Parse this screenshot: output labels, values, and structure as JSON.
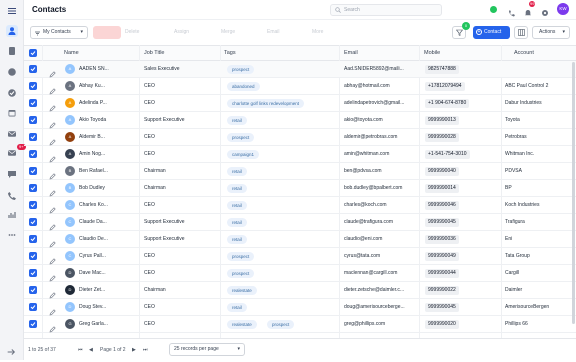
{
  "rail_items": [
    {
      "name": "menu-icon",
      "glyph": "menu"
    },
    {
      "name": "contacts-icon",
      "glyph": "person"
    },
    {
      "name": "building-icon",
      "glyph": "doc"
    },
    {
      "name": "deals-icon",
      "glyph": "circle"
    },
    {
      "name": "tasks-icon",
      "glyph": "check"
    },
    {
      "name": "calendar-icon",
      "glyph": "cal"
    },
    {
      "name": "mail-icon",
      "glyph": "mail"
    },
    {
      "name": "inbox-icon",
      "glyph": "mail",
      "badge": "9+"
    },
    {
      "name": "chat-icon",
      "glyph": "chat"
    },
    {
      "name": "phone-icon",
      "glyph": "phone"
    },
    {
      "name": "reports-icon",
      "glyph": "bars"
    },
    {
      "name": "more-icon",
      "glyph": "dots"
    }
  ],
  "header": {
    "title": "Contacts",
    "search_placeholder": "Search",
    "notif_count": "99",
    "avatar": "KW"
  },
  "toolbar": {
    "view": "My Contacts",
    "ghost": [
      "",
      "Delete",
      "Assign",
      "Merge",
      "Email",
      "More"
    ],
    "filter_count": "0",
    "add_label": "Contact",
    "actions_label": "Actions"
  },
  "columns": {
    "name": "Name",
    "job": "Job Title",
    "tags": "Tags",
    "email": "Email",
    "mobile": "Mobile",
    "account": "Account"
  },
  "rows": [
    {
      "name": "AADEN SN...",
      "init": "A",
      "color": "#93c5fd",
      "job": "Sales Executive",
      "tags": [
        "prospect"
      ],
      "email": "Aad.SNIDER5892@maili...",
      "mobile": "9825747888",
      "account": ""
    },
    {
      "name": "Abhay Ku...",
      "init": "A",
      "color": "#6b7280",
      "job": "CEO",
      "tags": [
        "abandoned"
      ],
      "email": "abhay@hotmail.com",
      "mobile": "+17812079494",
      "account": "ABC Paul Control 2"
    },
    {
      "name": "Adelinda P...",
      "init": "A",
      "color": "#f59e0b",
      "job": "CEO",
      "tags": [
        "charlotte golf links redevelopment"
      ],
      "email": "adelindapetrovich@gmail...",
      "mobile": "+1 904-674-8780",
      "account": "Dabur Industries"
    },
    {
      "name": "Akio Toyoda",
      "init": "A",
      "color": "#93c5fd",
      "job": "Support Executive",
      "tags": [
        "retail"
      ],
      "email": "akio@toyota.com",
      "mobile": "9999990013",
      "account": "Toyota"
    },
    {
      "name": "Aldemir B...",
      "init": "A",
      "color": "#92400e",
      "job": "CEO",
      "tags": [
        "prospect"
      ],
      "email": "aldemir@petrobras.com",
      "mobile": "9999990028",
      "account": "Petrobras"
    },
    {
      "name": "Amin Nog...",
      "init": "A",
      "color": "#374151",
      "job": "CEO",
      "tags": [
        "campaign1"
      ],
      "email": "amin@whitman.com",
      "mobile": "+1-541-754-3010",
      "account": "Whitman Inc."
    },
    {
      "name": "Ben Rafael...",
      "init": "B",
      "color": "#6b7280",
      "job": "Chairman",
      "tags": [
        "retail"
      ],
      "email": "ben@pdvsa.com",
      "mobile": "9999990040",
      "account": "PDVSA"
    },
    {
      "name": "Bob Dudley",
      "init": "B",
      "color": "#93c5fd",
      "job": "Chairman",
      "tags": [
        "retail"
      ],
      "email": "bob.dudley@bpalbert.com",
      "mobile": "9999990014",
      "account": "BP"
    },
    {
      "name": "Charles Ko...",
      "init": "C",
      "color": "#93c5fd",
      "job": "CEO",
      "tags": [
        "retail"
      ],
      "email": "charles@koch.com",
      "mobile": "9999990046",
      "account": "Koch Industries"
    },
    {
      "name": "Claude Da...",
      "init": "C",
      "color": "#93c5fd",
      "job": "Support Executive",
      "tags": [
        "retail"
      ],
      "email": "claude@trafigura.com",
      "mobile": "9999990045",
      "account": "Trafigura"
    },
    {
      "name": "Claudio De...",
      "init": "C",
      "color": "#93c5fd",
      "job": "Support Executive",
      "tags": [
        "retail"
      ],
      "email": "claudio@eni.com",
      "mobile": "9999990036",
      "account": "Eni"
    },
    {
      "name": "Cyrus Pall...",
      "init": "C",
      "color": "#93c5fd",
      "job": "CEO",
      "tags": [
        "prospect"
      ],
      "email": "cyrus@tata.com",
      "mobile": "9999990049",
      "account": "Tata Group"
    },
    {
      "name": "Dave Mac...",
      "init": "D",
      "color": "#4b5563",
      "job": "CEO",
      "tags": [
        "prospect"
      ],
      "email": "maclennan@cargill.com",
      "mobile": "9999990044",
      "account": "Cargill"
    },
    {
      "name": "Dieter Zet...",
      "init": "D",
      "color": "#1f2937",
      "job": "Chairman",
      "tags": [
        "realestate"
      ],
      "email": "dieter.zetsche@daimler.c...",
      "mobile": "9999990022",
      "account": "Daimler"
    },
    {
      "name": "Doug Stev...",
      "init": "D",
      "color": "#93c5fd",
      "job": "CEO",
      "tags": [
        "retail"
      ],
      "email": "doug@amerisourceberge...",
      "mobile": "9999990045",
      "account": "AmerisourceBergen"
    },
    {
      "name": "Greg Garla...",
      "init": "G",
      "color": "#4b5563",
      "job": "CEO",
      "tags": [
        "realestate",
        "prospect"
      ],
      "email": "greg@phillips.com",
      "mobile": "9999990020",
      "account": "Phillips 66"
    }
  ],
  "footer": {
    "range": "1 to 25 of 37",
    "page": "Page 1 of 2",
    "per_page": "25 records per page"
  },
  "colors": {
    "accent": "#2563eb",
    "tag_bg": "#eaf1fb",
    "tag_text": "#3a6ea5"
  }
}
